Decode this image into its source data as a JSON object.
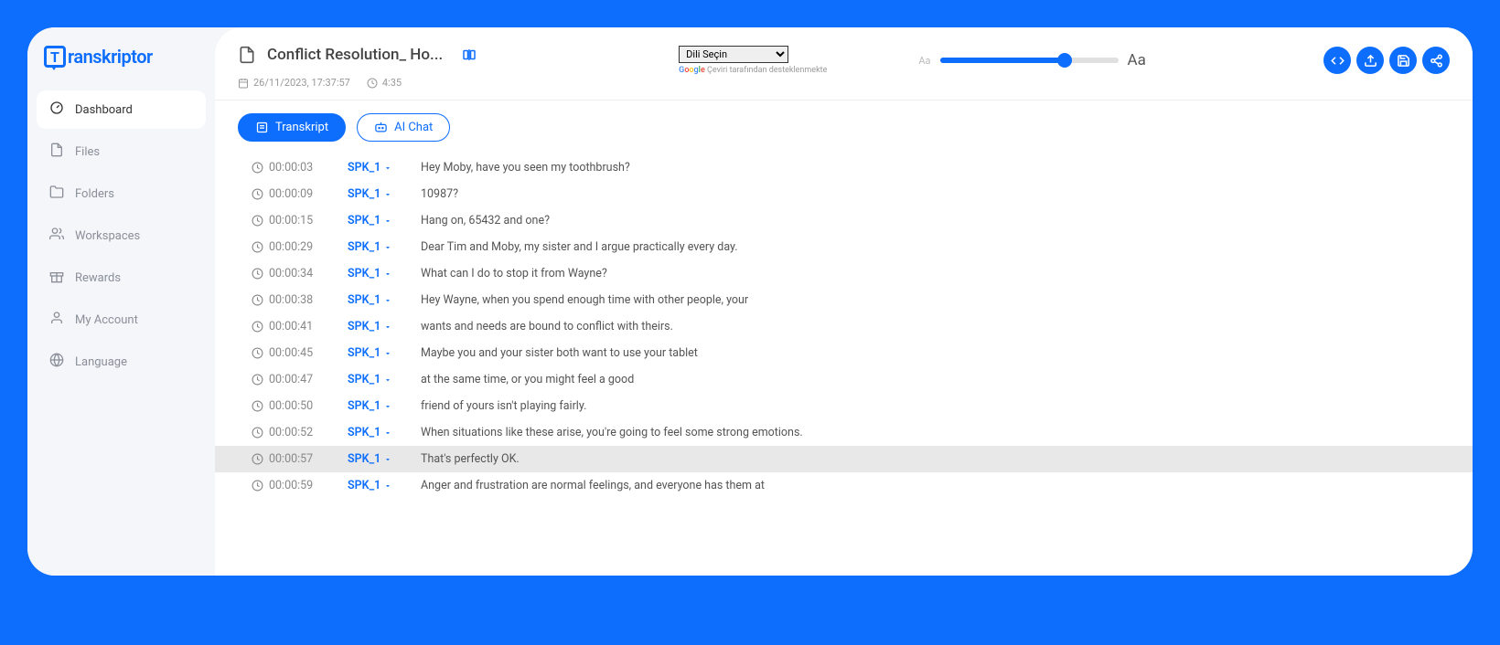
{
  "logo": {
    "text": "ranskriptor",
    "iconLetter": "T"
  },
  "sidebar": {
    "items": [
      {
        "label": "Dashboard",
        "active": true,
        "icon": "dashboard"
      },
      {
        "label": "Files",
        "active": false,
        "icon": "file"
      },
      {
        "label": "Folders",
        "active": false,
        "icon": "folder"
      },
      {
        "label": "Workspaces",
        "active": false,
        "icon": "workspace"
      },
      {
        "label": "Rewards",
        "active": false,
        "icon": "gift"
      },
      {
        "label": "My Account",
        "active": false,
        "icon": "user"
      },
      {
        "label": "Language",
        "active": false,
        "icon": "globe"
      }
    ]
  },
  "header": {
    "title": "Conflict Resolution_ Ho...",
    "date": "26/11/2023, 17:37:57",
    "duration": "4:35",
    "langSelect": "Dili Seçin",
    "langNote": "Çeviri tarafından desteklenmekte",
    "fontSmall": "Aa",
    "fontBig": "Aa",
    "sliderPercent": 70
  },
  "tabs": {
    "transcript": "Transkript",
    "aichat": "AI Chat"
  },
  "transcript": [
    {
      "time": "00:00:03",
      "speaker": "SPK_1",
      "text": "Hey Moby, have you seen my toothbrush?",
      "hl": false
    },
    {
      "time": "00:00:09",
      "speaker": "SPK_1",
      "text": "10987?",
      "hl": false
    },
    {
      "time": "00:00:15",
      "speaker": "SPK_1",
      "text": "Hang on, 65432 and one?",
      "hl": false
    },
    {
      "time": "00:00:29",
      "speaker": "SPK_1",
      "text": "Dear Tim and Moby, my sister and I argue practically every day.",
      "hl": false
    },
    {
      "time": "00:00:34",
      "speaker": "SPK_1",
      "text": "What can I do to stop it from Wayne?",
      "hl": false
    },
    {
      "time": "00:00:38",
      "speaker": "SPK_1",
      "text": "Hey Wayne, when you spend enough time with other people, your",
      "hl": false
    },
    {
      "time": "00:00:41",
      "speaker": "SPK_1",
      "text": "wants and needs are bound to conflict with theirs.",
      "hl": false
    },
    {
      "time": "00:00:45",
      "speaker": "SPK_1",
      "text": "Maybe you and your sister both want to use your tablet",
      "hl": false
    },
    {
      "time": "00:00:47",
      "speaker": "SPK_1",
      "text": "at the same time, or you might feel a good",
      "hl": false
    },
    {
      "time": "00:00:50",
      "speaker": "SPK_1",
      "text": "friend of yours isn't playing fairly.",
      "hl": false
    },
    {
      "time": "00:00:52",
      "speaker": "SPK_1",
      "text": "When situations like these arise, you're going to feel some strong emotions.",
      "hl": false
    },
    {
      "time": "00:00:57",
      "speaker": "SPK_1",
      "text": "That's perfectly OK.",
      "hl": true
    },
    {
      "time": "00:00:59",
      "speaker": "SPK_1",
      "text": "Anger and frustration are normal feelings, and everyone has them at",
      "hl": false
    }
  ]
}
